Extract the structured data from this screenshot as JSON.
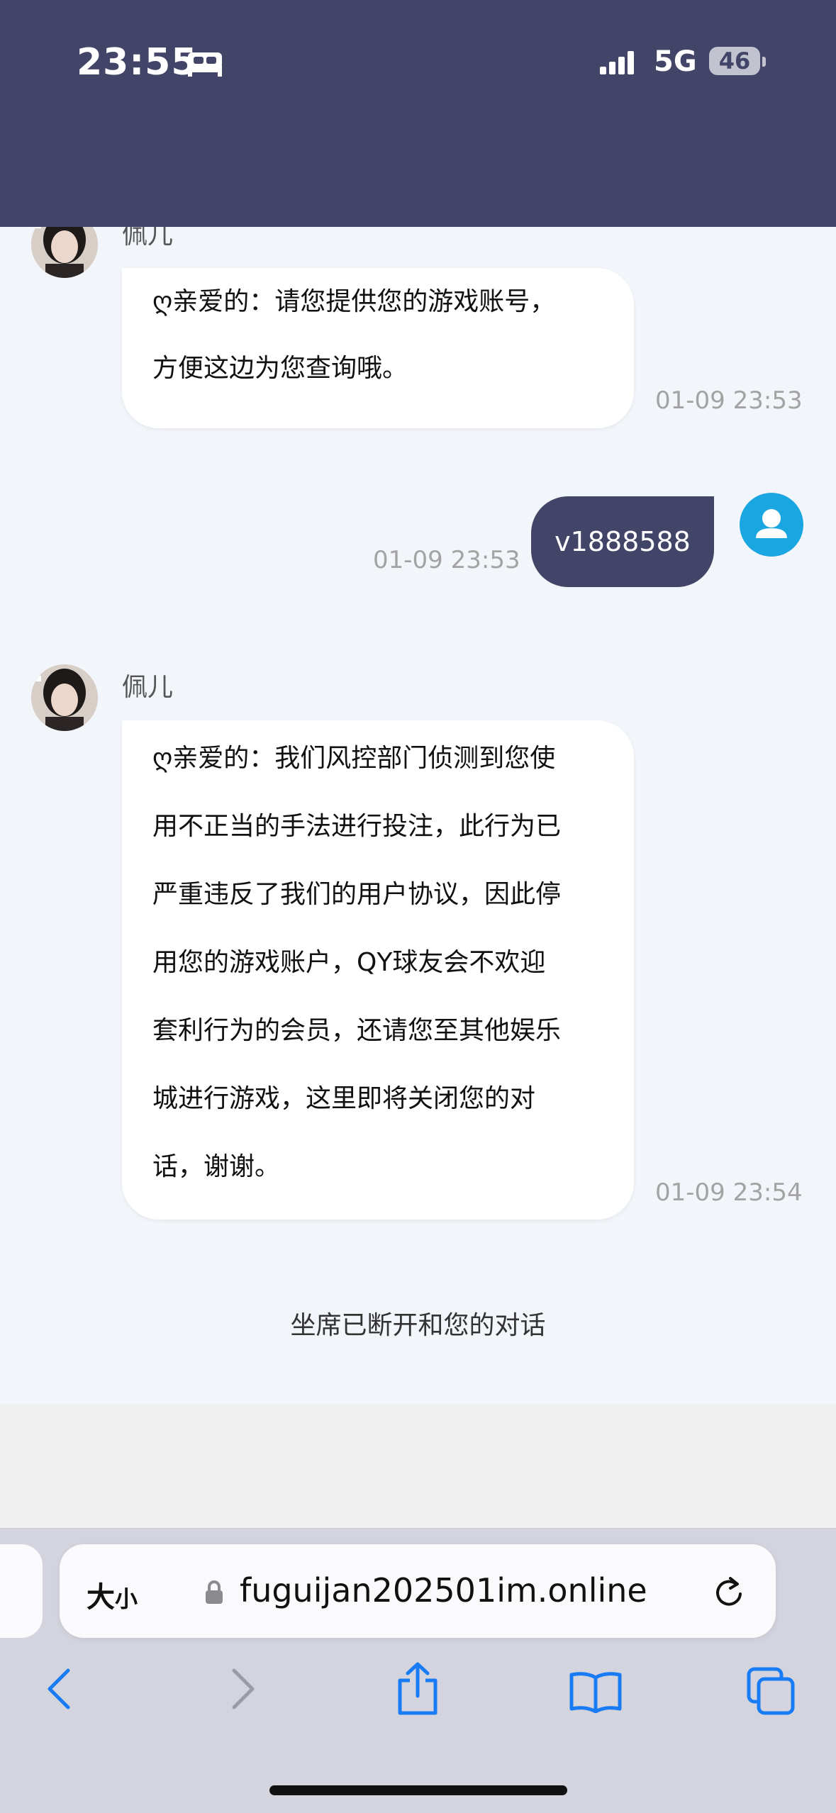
{
  "status_bar": {
    "time": "23:55",
    "network": "5G",
    "battery": "46"
  },
  "messages": [
    {
      "sender": "佩儿",
      "lines": [
        "ღ亲爱的：请您提供您的游戏账号，",
        "方便这边为您查询哦。"
      ],
      "time": "01-09 23:53"
    },
    {
      "text": "v1888588",
      "time": "01-09 23:53"
    },
    {
      "sender": "佩儿",
      "lines": [
        "ღ亲爱的：我们风控部门侦测到您使",
        "用不正当的手法进行投注，此行为已",
        "严重违反了我们的用户协议，因此停",
        "用您的游戏账户，QY球友会不欢迎",
        "套利行为的会员，还请您至其他娱乐",
        "城进行游戏，这里即将关闭您的对",
        "话，谢谢。"
      ],
      "time": "01-09 23:54"
    }
  ],
  "system_notice": "坐席已断开和您的对话",
  "browser": {
    "text_size_label": "大",
    "text_size_label_small": "小",
    "url": "fuguijan202501im.online"
  },
  "colors": {
    "header": "#424468",
    "chat_bg": "#f2f5f9",
    "user_bubble": "#424468",
    "accent": "#1a7cf5"
  }
}
